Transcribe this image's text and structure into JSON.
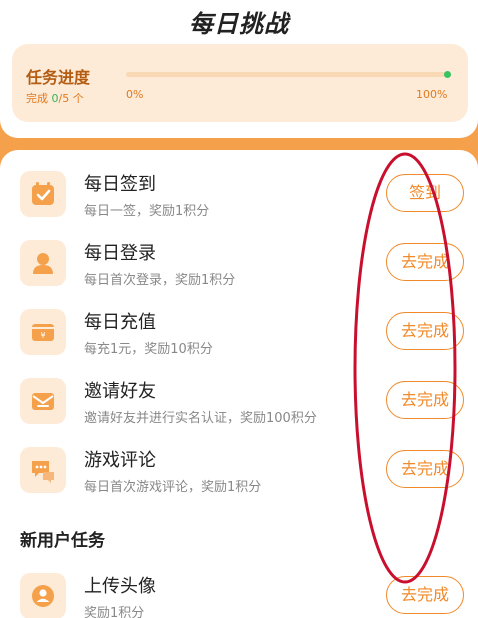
{
  "header": {
    "title": "每日挑战"
  },
  "progress": {
    "title": "任务进度",
    "done_prefix": "完成 ",
    "done_count": "0",
    "done_suffix": "/5 个",
    "start_label": "0%",
    "end_label": "100%",
    "fraction": 0
  },
  "tasks": [
    {
      "title": "每日签到",
      "desc": "每日一签，奖励1积分",
      "button": "签到",
      "icon": "calendar-check-icon"
    },
    {
      "title": "每日登录",
      "desc": "每日首次登录，奖励1积分",
      "button": "去完成",
      "icon": "user-icon"
    },
    {
      "title": "每日充值",
      "desc": "每充1元，奖励10积分",
      "button": "去完成",
      "icon": "yuan-card-icon"
    },
    {
      "title": "邀请好友",
      "desc": "邀请好友并进行实名认证，奖励100积分",
      "button": "去完成",
      "icon": "envelope-icon"
    },
    {
      "title": "游戏评论",
      "desc": "每日首次游戏评论，奖励1积分",
      "button": "去完成",
      "icon": "chat-bubble-icon"
    }
  ],
  "new_user": {
    "section_title": "新用户任务",
    "tasks": [
      {
        "title": "上传头像",
        "desc": "奖励1积分",
        "button": "去完成",
        "icon": "avatar-upload-icon"
      }
    ]
  },
  "colors": {
    "accent": "#f08a2a",
    "page_bg": "#f5a04a",
    "card_bg": "#fdebd7",
    "annotation": "#c8102e"
  }
}
